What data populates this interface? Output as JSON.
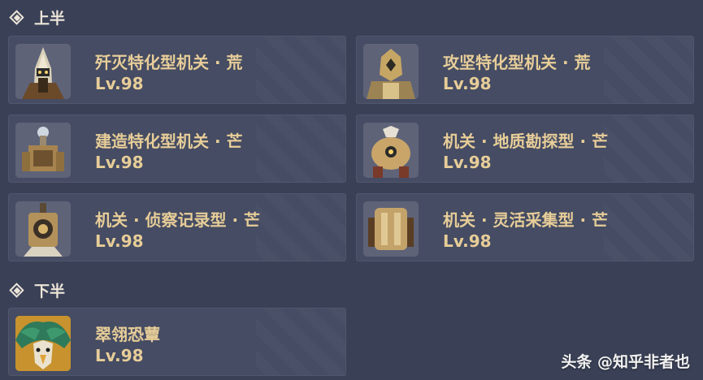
{
  "sections": {
    "upper": {
      "label": "上半"
    },
    "lower": {
      "label": "下半"
    }
  },
  "upper_enemies": [
    {
      "name": "歼灭特化型机关 · 荒",
      "level": "Lv.98",
      "icon": "annihilation-machine-portrait"
    },
    {
      "name": "攻坚特化型机关 · 荒",
      "level": "Lv.98",
      "icon": "assault-machine-portrait"
    },
    {
      "name": "建造特化型机关 · 芒",
      "level": "Lv.98",
      "icon": "construction-machine-portrait"
    },
    {
      "name": "机关 · 地质勘探型 · 芒",
      "level": "Lv.98",
      "icon": "survey-machine-portrait"
    },
    {
      "name": "机关 · 侦察记录型 · 芒",
      "level": "Lv.98",
      "icon": "recon-machine-portrait"
    },
    {
      "name": "机关 · 灵活采集型 · 芒",
      "level": "Lv.98",
      "icon": "collector-machine-portrait"
    }
  ],
  "lower_enemies": [
    {
      "name": "翠翎恐蕈",
      "level": "Lv.98",
      "icon": "jadeplume-terrorshroom-portrait"
    }
  ],
  "watermark": "头条 @知乎非者也",
  "colors": {
    "background": "#3a4157",
    "card": "#454c63",
    "name_gold": "#e7cd98",
    "header_text": "#ece5d8"
  }
}
